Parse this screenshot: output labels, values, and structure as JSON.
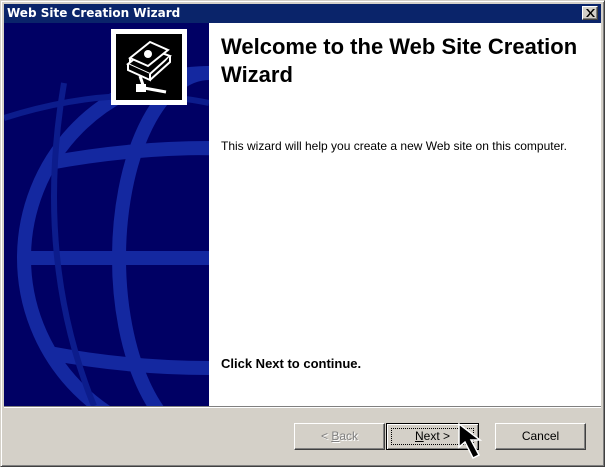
{
  "window": {
    "title": "Web Site Creation Wizard",
    "close_icon": "close-icon"
  },
  "sidebar": {
    "graphic": "globe-graphic",
    "icon": "web-site-wizard-icon"
  },
  "main": {
    "title": "Welcome to the Web Site Creation Wizard",
    "description": "This wizard will help you create a new Web site on this computer.",
    "continue_text": "Click Next to continue."
  },
  "buttons": {
    "back": {
      "text": "< ",
      "mnemonic": "B",
      "rest": "ack",
      "enabled": false
    },
    "next": {
      "mnemonic": "N",
      "rest": "ext >",
      "focused": true
    },
    "cancel": {
      "label": "Cancel"
    }
  },
  "colors": {
    "titlebar": "#0a246a",
    "sidebar": "#000064",
    "globe_lines": "#1428a0"
  }
}
